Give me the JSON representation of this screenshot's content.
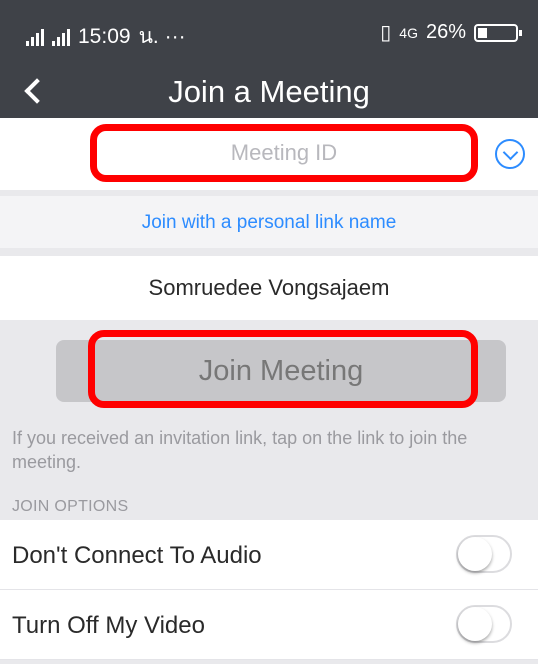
{
  "status_bar": {
    "time": "15:09",
    "extras": "น. ···",
    "network": "4G",
    "battery_percent": "26%",
    "battery_level": 0.26
  },
  "nav": {
    "title": "Join a Meeting"
  },
  "meeting_id": {
    "placeholder": "Meeting ID",
    "value": ""
  },
  "personal_link": {
    "label": "Join with a personal link name"
  },
  "display_name": "Somruedee Vongsajaem",
  "join_button": {
    "label": "Join Meeting"
  },
  "helper_text": "If you received an invitation link, tap on the link to join the meeting.",
  "join_options": {
    "header": "JOIN OPTIONS",
    "options": [
      {
        "label": "Don't Connect To Audio",
        "enabled": false
      },
      {
        "label": "Turn Off My Video",
        "enabled": false
      }
    ]
  },
  "icons": {
    "back": "chevron-left-icon",
    "dropdown": "chevron-down-circle-icon",
    "signal": "signal-icon",
    "battery": "battery-icon",
    "vibrate": "vibrate-icon"
  },
  "colors": {
    "header_bg": "#3f4248",
    "accent": "#2d8cff",
    "highlight": "#ff0000",
    "join_button_bg": "#c6c6c9"
  }
}
